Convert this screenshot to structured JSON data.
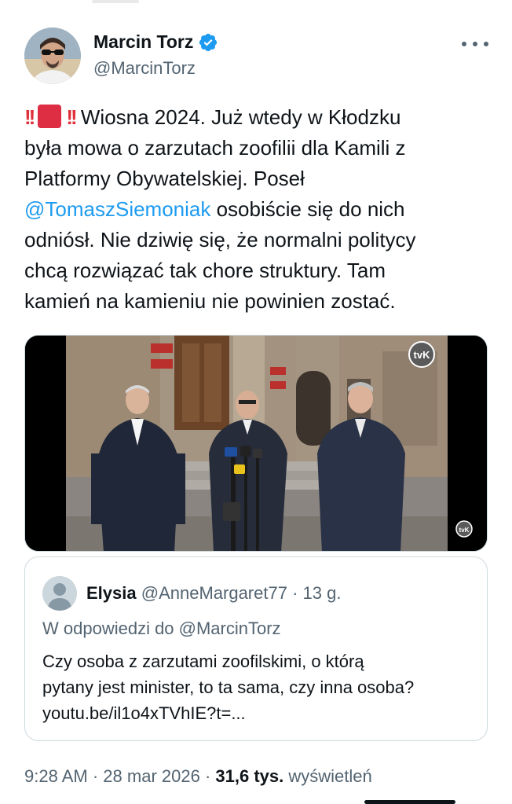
{
  "author": {
    "display_name": "Marcin Torz",
    "handle": "@MarcinTorz",
    "verified": true
  },
  "tweet": {
    "lines": [
      {
        "prefix_emoji": "‼️ 🟥 ‼️",
        "text": "Wiosna 2024. Już wtedy w Kłodzku"
      },
      {
        "text": "była mowa o zarzutach zoofilii dla Kamili z"
      },
      {
        "text": "Platformy Obywatelskiej. Poseł"
      },
      {
        "mention": "@TomaszSiemoniak",
        "text": " osobiście się do nich"
      },
      {
        "text": "odniósł. Nie dziwię się, że normalni politycy"
      },
      {
        "text": "chcą rozwiązać tak chore struktury. Tam"
      },
      {
        "text": "kamień na kamieniu nie powinien zostać."
      }
    ]
  },
  "media": {
    "watermark_top": "tvK",
    "watermark_bottom": "tvK"
  },
  "quote": {
    "display_name": "Elysia",
    "handle": "@AnneMargaret77",
    "age": "13 g.",
    "reply_to": "W odpowiedzi do @MarcinTorz",
    "body_lines": [
      "Czy osoba z zarzutami zoofilskimi, o którą",
      "pytany jest minister, to ta sama, czy inna osoba?",
      "youtu.be/il1o4xTVhIE?t=..."
    ]
  },
  "meta": {
    "time": "9:28 AM",
    "date": "28 mar 2026",
    "views_count": "31,6 tys.",
    "views_label": "wyświetleń"
  },
  "colors": {
    "accent": "#1d9bf0",
    "secondary_text": "#536471",
    "primary_text": "#0f1419",
    "border": "#cfd9de"
  },
  "icons": {
    "verified": "verified-badge-icon",
    "more": "more-horizontal-icon"
  }
}
